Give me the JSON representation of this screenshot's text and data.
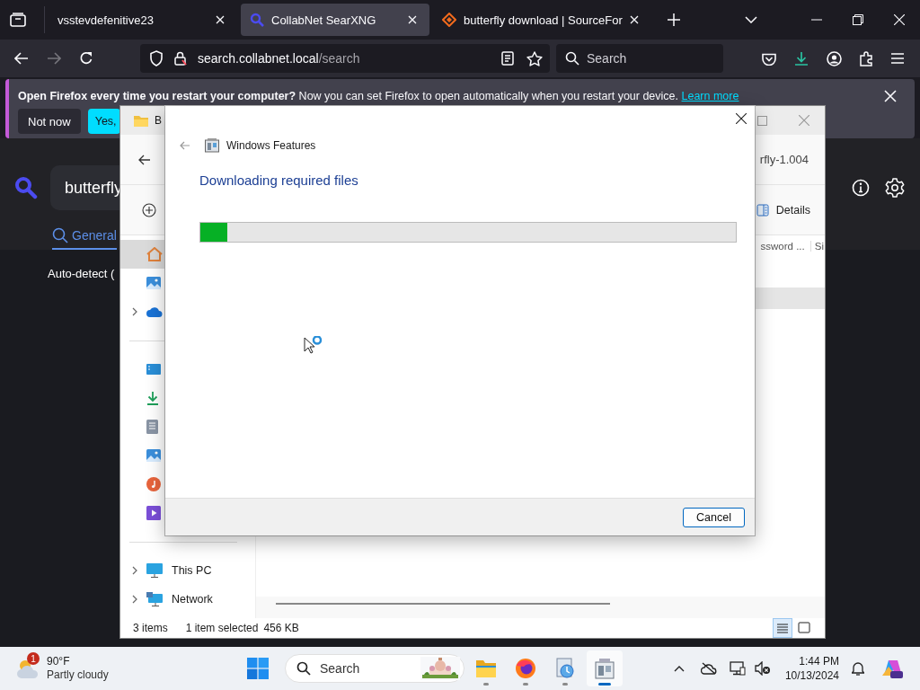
{
  "browser": {
    "tabs": [
      {
        "title": "vsstevdefenitive23",
        "kind": "none",
        "selected": false
      },
      {
        "title": "CollabNet SearXNG",
        "kind": "magnifier",
        "selected": true
      },
      {
        "title": "butterfly download | SourceFor",
        "kind": "diamond",
        "selected": false
      }
    ],
    "url_host": "search.collabnet.local",
    "url_path": "/search",
    "search_placeholder": "Search",
    "notification": {
      "message": "**Open Firefox every time you restart your computer?** Now you can set Firefox to open automatically when you restart your device.",
      "link": "Learn more",
      "buttons": [
        "Not now",
        "Yes,"
      ]
    },
    "page": {
      "query": "butterfly",
      "category": {
        "label": "General",
        "selected": true
      },
      "language": "Auto-detect ("
    }
  },
  "explorer": {
    "title": "B",
    "path": "rfly-1.004",
    "details_button": "Details",
    "columns": [
      "ssword ...",
      "Si"
    ],
    "rows": [
      {
        "selected": false
      },
      {
        "selected": true
      }
    ],
    "nav_items": [
      {
        "kind": "home",
        "selected": true,
        "expandable": false
      },
      {
        "kind": "gallery",
        "selected": false,
        "expandable": false
      },
      {
        "kind": "cloud",
        "selected": false,
        "expandable": true
      },
      {
        "kind": "divider",
        "selected": false,
        "expandable": false
      },
      {
        "kind": "desktop",
        "selected": false,
        "expandable": false
      },
      {
        "kind": "downloads",
        "selected": false,
        "expandable": false
      },
      {
        "kind": "documents",
        "selected": false,
        "expandable": false
      },
      {
        "kind": "pictures",
        "selected": false,
        "expandable": false
      },
      {
        "kind": "music",
        "selected": false,
        "expandable": false
      },
      {
        "kind": "videos",
        "selected": false,
        "expandable": false
      },
      {
        "kind": "divider",
        "selected": false,
        "expandable": false
      },
      {
        "kind": "pc",
        "label": "This PC",
        "selected": false,
        "expandable": true
      },
      {
        "kind": "network",
        "label": "Network",
        "selected": false,
        "expandable": true
      }
    ],
    "status": [
      "3 items",
      "1 item selected",
      "456 KB"
    ],
    "views": [
      {
        "kind": "details",
        "selected": true
      },
      {
        "kind": "tiles",
        "selected": false
      }
    ]
  },
  "dialog": {
    "title": "Windows Features",
    "heading": "Downloading required files",
    "progress": {
      "level": 0.05
    },
    "button": "Cancel"
  },
  "taskbar": {
    "weather": {
      "badge": "1",
      "temperature": "90°F",
      "condition": "Partly cloudy"
    },
    "search_placeholder": "Search",
    "apps": [
      {
        "kind": "folder",
        "selected": false
      },
      {
        "kind": "firefox",
        "selected": false
      },
      {
        "kind": "setup",
        "selected": false
      },
      {
        "kind": "features",
        "selected": true
      }
    ],
    "time": "1:44 PM",
    "date": "10/13/2024"
  }
}
